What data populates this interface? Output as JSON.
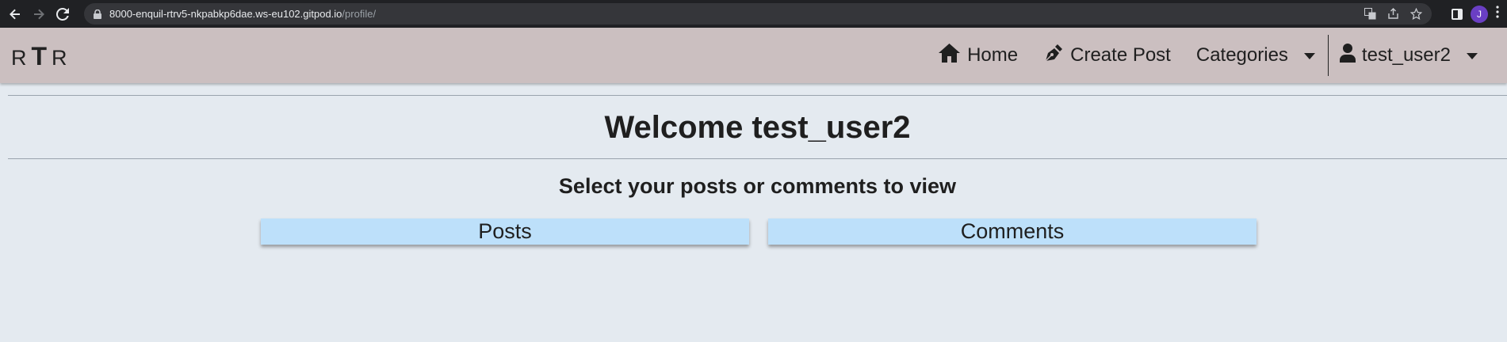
{
  "browser": {
    "url_host": "8000-enquil-rtrv5-nkpabkp6dae.ws-eu102.gitpod.io",
    "url_path": "/profile/",
    "profile_initial": "J"
  },
  "navbar": {
    "brand_left": "R",
    "brand_mid": "T",
    "brand_right": "R",
    "home_label": "Home",
    "create_post_label": "Create Post",
    "categories_label": "Categories",
    "user_label": "test_user2"
  },
  "main": {
    "welcome_heading": "Welcome test_user2",
    "subtitle": "Select your posts or comments to view",
    "posts_button": "Posts",
    "comments_button": "Comments"
  },
  "colors": {
    "navbar_bg": "#cbbfc0",
    "page_bg": "#e4eaf0",
    "button_bg": "#bde0fa",
    "avatar_bg": "#6a3fc4"
  }
}
